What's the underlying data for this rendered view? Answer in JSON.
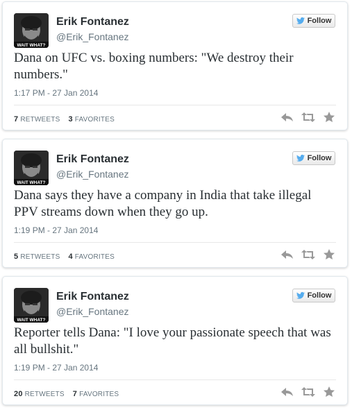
{
  "tweets": [
    {
      "name": "Erik Fontanez",
      "handle": "@Erik_Fontanez",
      "follow_label": "Follow",
      "avatar_caption": "WAIT WHAT?",
      "text": "Dana on UFC vs. boxing numbers: \"We destroy their numbers.\"",
      "timestamp": "1:17 PM - 27 Jan 2014",
      "retweets": "7",
      "retweets_label": "RETWEETS",
      "favorites": "3",
      "favorites_label": "FAVORITES"
    },
    {
      "name": "Erik Fontanez",
      "handle": "@Erik_Fontanez",
      "follow_label": "Follow",
      "avatar_caption": "WAIT WHAT?",
      "text": "Dana says they have a company in India that take illegal PPV streams down when they go up.",
      "timestamp": "1:19 PM - 27 Jan 2014",
      "retweets": "5",
      "retweets_label": "RETWEETS",
      "favorites": "4",
      "favorites_label": "FAVORITES"
    },
    {
      "name": "Erik Fontanez",
      "handle": "@Erik_Fontanez",
      "follow_label": "Follow",
      "avatar_caption": "WAIT WHAT?",
      "text": "Reporter tells Dana: \"I love your passionate speech that was all bullshit.\"",
      "timestamp": "1:19 PM - 27 Jan 2014",
      "retweets": "20",
      "retweets_label": "RETWEETS",
      "favorites": "7",
      "favorites_label": "FAVORITES"
    }
  ],
  "icons": {
    "follow": "twitter-bird-icon",
    "reply": "reply-icon",
    "retweet": "retweet-icon",
    "favorite": "star-icon"
  },
  "colors": {
    "twitter_blue": "#55acee",
    "action_gray": "#999999",
    "muted_text": "#66757f",
    "card_border": "#e1e8ed"
  }
}
